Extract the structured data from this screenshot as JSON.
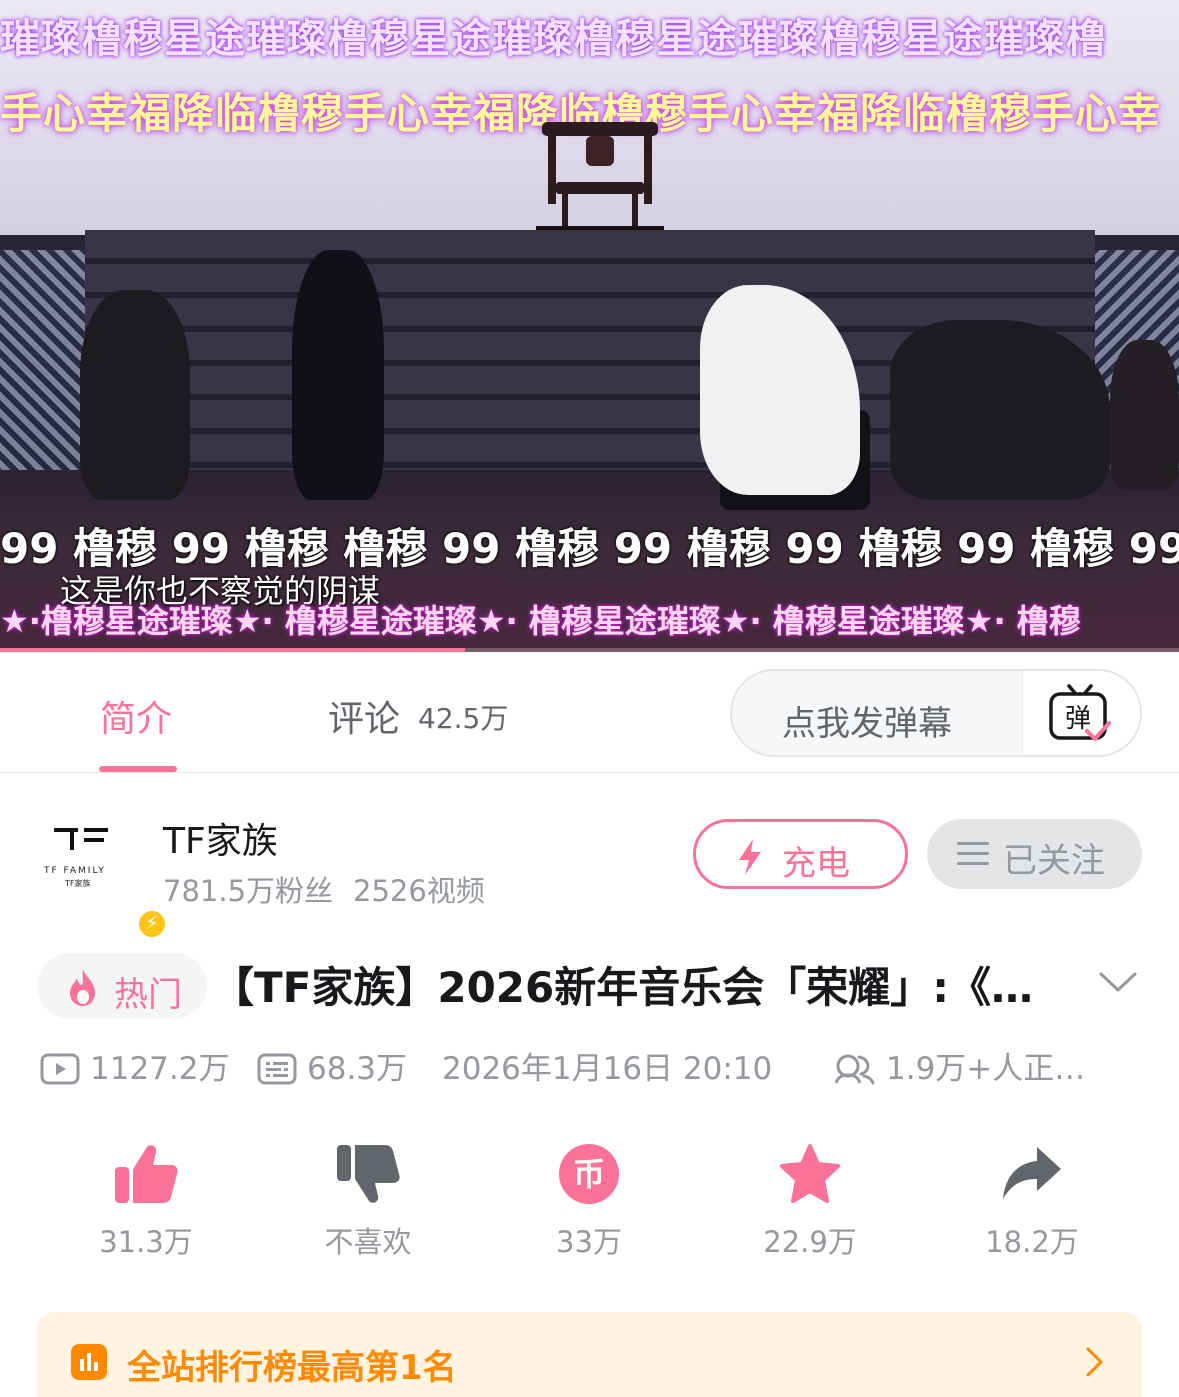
{
  "video": {
    "scroll_line_1": "璀璨橹穆星途璀璨橹穆星途璀璨橹穆星途璀璨橹穆星途璀璨橹",
    "scroll_line_2": "手心幸福降临橹穆手心幸福降临橹穆手心幸福降临橹穆手心幸",
    "danmaku_big": "99 橹穆 99 橹穆     橹穆 99 橹穆 99 橹穆 99 橹穆 99 橹穆 99",
    "subtitle": "这是你也不察觉的阴谋",
    "danmaku_pink": "★·橹穆星途璀璨★·  橹穆星途璀璨★·  橹穆星途璀璨★·  橹穆星途璀璨★·  橹穆",
    "progress_fraction": 0.394
  },
  "tabs": {
    "intro_label": "简介",
    "comments_label": "评论",
    "comments_count": "42.5万",
    "danmaku_placeholder": "点我发弹幕",
    "danmaku_toggle_glyph": "弹"
  },
  "uploader": {
    "name": "TF家族",
    "logo_text": "TF FAMILY",
    "logo_subtext": "TF家族",
    "followers": "781.5万粉丝",
    "videos": "2526视频",
    "charge_label": "充电",
    "followed_label": "已关注"
  },
  "title": {
    "hot_label": "热门",
    "text": "【TF家族】2026新年音乐会「荣耀」:《…"
  },
  "meta": {
    "views": "1127.2万",
    "danmaku_count": "68.3万",
    "datetime": "2026年1月16日 20:10",
    "watching": "1.9万+人正…"
  },
  "actions": {
    "like": "31.3万",
    "dislike": "不喜欢",
    "coin": "33万",
    "coin_glyph": "币",
    "favorite": "22.9万",
    "share": "18.2万"
  },
  "ranking": {
    "label": "全站排行榜最高第1名"
  },
  "colors": {
    "accent_pink": "#fb7299",
    "secondary_text": "#9499a0",
    "rank_orange": "#ff8a00",
    "rank_bg": "#fff3e2",
    "badge_yellow": "#ffc61a"
  },
  "icons": {
    "danmaku_toggle": "danmaku-tv-icon",
    "charge": "lightning-icon",
    "followed": "menu-lines-icon",
    "hot": "flame-icon",
    "expand": "chevron-down-icon",
    "views": "play-box-icon",
    "danmaku": "danmaku-list-icon",
    "watching": "people-icon",
    "like": "thumbs-up-icon",
    "dislike": "thumbs-down-icon",
    "coin": "coin-icon",
    "favorite": "star-icon",
    "share": "share-arrow-icon",
    "ranking": "bar-chart-icon",
    "ranking_chevron": "chevron-right-icon"
  }
}
